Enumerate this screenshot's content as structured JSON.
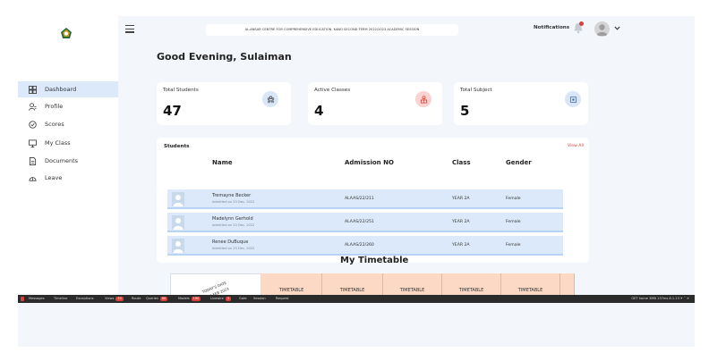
{
  "sidebar": {
    "items": [
      {
        "label": "Dashboard",
        "icon": "dashboard-icon",
        "active": true
      },
      {
        "label": "Profile",
        "icon": "profile-icon"
      },
      {
        "label": "Scores",
        "icon": "scores-icon"
      },
      {
        "label": "My Class",
        "icon": "class-icon"
      },
      {
        "label": "Documents",
        "icon": "documents-icon"
      },
      {
        "label": "Leave",
        "icon": "leave-icon"
      }
    ]
  },
  "header": {
    "school_session": "AL-ANSAR CENTRE FOR COMPREHENSIVE EDUCATION, KANO   SECOND TERM 2022/2023 ACADEMIC SESSION",
    "notifications_label": "Notifications"
  },
  "greeting": "Good Evening, Sulaiman",
  "stats": {
    "total_students": {
      "label": "Total Students",
      "value": "47"
    },
    "active_classes": {
      "label": "Active Classes",
      "value": "4"
    },
    "total_subject": {
      "label": "Total Subject",
      "value": "5"
    }
  },
  "students": {
    "title": "Students",
    "view_all": "View All",
    "columns": {
      "name": "Name",
      "admission": "Admission NO",
      "class": "Class",
      "gender": "Gender"
    },
    "rows": [
      {
        "name": "Tremayne Becker",
        "admitted": "Admitted on 23 Dec, 2022",
        "admission": "ALAAS/22/211",
        "class": "YEAR 2A",
        "gender": "Female"
      },
      {
        "name": "Madelynn Gerhold",
        "admitted": "Admitted on 23 Dec, 2022",
        "admission": "ALAAS/22/251",
        "class": "YEAR 2A",
        "gender": "Female"
      },
      {
        "name": "Renee DuBuque",
        "admitted": "Admitted on 23 Dec, 2022",
        "admission": "ALAAS/22/260",
        "class": "YEAR 2A",
        "gender": "Female"
      }
    ]
  },
  "timetable": {
    "title": "My Timetable",
    "date_label": "TODAY'S DATE",
    "date_value": "14 FEB 2023",
    "column_label": "TIMETABLE"
  },
  "debugbar": {
    "items": [
      {
        "label": "Messages"
      },
      {
        "label": "Timeline"
      },
      {
        "label": "Exceptions"
      },
      {
        "label": "Views",
        "badge": "33"
      },
      {
        "label": "Route"
      },
      {
        "label": "Queries",
        "badge": "60"
      },
      {
        "label": "Models",
        "badge": "190"
      },
      {
        "label": "Livewire",
        "badge": "3"
      },
      {
        "label": "Gate"
      },
      {
        "label": "Session"
      },
      {
        "label": "Request"
      }
    ],
    "status": "GET home   3MB   137ms   8.1.13"
  },
  "colors": {
    "accent_blue": "#dbe9fa",
    "danger": "#d9413a",
    "timetable": "#fbd9c4"
  }
}
